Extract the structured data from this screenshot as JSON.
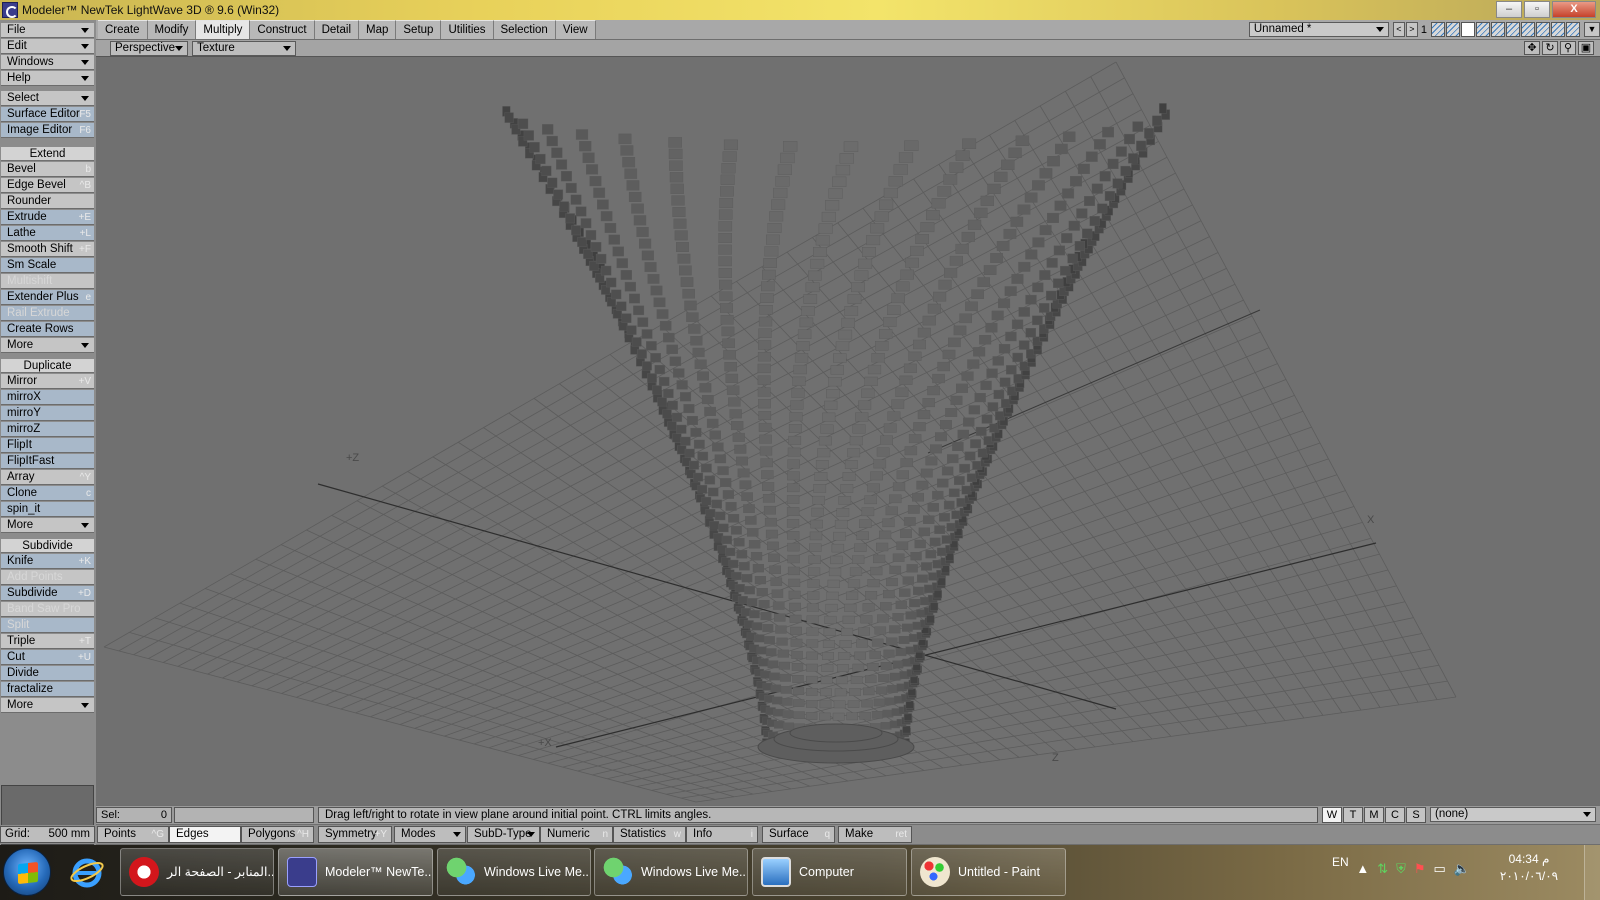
{
  "window": {
    "title": "Modeler™ NewTek LightWave 3D ® 9.6  (Win32)",
    "min": "–",
    "max": "▫",
    "close": "X"
  },
  "tabs": [
    "Create",
    "Modify",
    "Multiply",
    "Construct",
    "Detail",
    "Map",
    "Setup",
    "Utilities",
    "Selection",
    "View"
  ],
  "active_tab": "Multiply",
  "layer": {
    "name": "Unnamed *",
    "number": "1"
  },
  "left_menus": [
    "File",
    "Edit",
    "Windows",
    "Help"
  ],
  "left_tools": {
    "select": "Select",
    "surface_editor": "Surface Editor",
    "surface_key": "F5",
    "image_editor": "Image Editor",
    "image_key": "F6"
  },
  "extend": {
    "header": "Extend",
    "items": [
      {
        "label": "Bevel",
        "key": "b"
      },
      {
        "label": "Edge Bevel",
        "key": "^B"
      },
      {
        "label": "Rounder",
        "key": ""
      },
      {
        "label": "Extrude",
        "key": "+E"
      },
      {
        "label": "Lathe",
        "key": "+L"
      },
      {
        "label": "Smooth Shift",
        "key": "+F"
      },
      {
        "label": "Sm Scale",
        "key": ""
      },
      {
        "label": "Multishift",
        "key": ""
      },
      {
        "label": "Extender Plus",
        "key": "e"
      },
      {
        "label": "Rail Extrude",
        "key": ""
      },
      {
        "label": "Create Rows",
        "key": ""
      },
      {
        "label": "More",
        "key": ""
      }
    ]
  },
  "duplicate": {
    "header": "Duplicate",
    "items": [
      {
        "label": "Mirror",
        "key": "+V"
      },
      {
        "label": "mirroX",
        "key": ""
      },
      {
        "label": "mirroY",
        "key": ""
      },
      {
        "label": "mirroZ",
        "key": ""
      },
      {
        "label": "FlipIt",
        "key": ""
      },
      {
        "label": "FlipItFast",
        "key": ""
      },
      {
        "label": "Array",
        "key": "^Y"
      },
      {
        "label": "Clone",
        "key": "c"
      },
      {
        "label": "spin_it",
        "key": ""
      },
      {
        "label": "More",
        "key": ""
      }
    ]
  },
  "subdivide": {
    "header": "Subdivide",
    "items": [
      {
        "label": "Knife",
        "key": "+K"
      },
      {
        "label": "Add Points",
        "key": ""
      },
      {
        "label": "Subdivide",
        "key": "+D"
      },
      {
        "label": "Band Saw Pro",
        "key": ""
      },
      {
        "label": "Split",
        "key": ""
      },
      {
        "label": "Triple",
        "key": "+T"
      },
      {
        "label": "Cut",
        "key": "+U"
      },
      {
        "label": "Divide",
        "key": ""
      },
      {
        "label": "fractalize",
        "key": ""
      },
      {
        "label": "More",
        "key": ""
      }
    ]
  },
  "viewport": {
    "view": "Perspective",
    "render": "Texture",
    "axis_labels": [
      "+Z",
      "X",
      "+X",
      "Z"
    ],
    "icons": [
      "move-icon",
      "rotate-icon",
      "zoom-icon",
      "maximize-icon"
    ]
  },
  "status": {
    "sel_label": "Sel:",
    "sel_value": "0",
    "message": "Drag left/right to rotate in view plane around initial point. CTRL limits angles.",
    "view_buttons": [
      "W",
      "T",
      "M",
      "C",
      "S"
    ],
    "active_view_button": "W",
    "surface_filter": "(none)",
    "grid_label": "Grid:",
    "grid_value": "500 mm",
    "modes": [
      {
        "label": "Points",
        "key": "^G"
      },
      {
        "label": "Edges",
        "key": ""
      },
      {
        "label": "Polygons",
        "key": "^H"
      },
      {
        "label": "Symmetry",
        "key": "+Y"
      },
      {
        "label": "Modes",
        "key": ""
      },
      {
        "label": "SubD-Type",
        "key": ""
      },
      {
        "label": "Numeric",
        "key": "n"
      },
      {
        "label": "Statistics",
        "key": "w"
      },
      {
        "label": "Info",
        "key": "i"
      },
      {
        "label": "Surface",
        "key": "q"
      },
      {
        "label": "Make",
        "key": "ret"
      }
    ],
    "active_mode": "Edges"
  },
  "taskbar": {
    "tasks": [
      "المنابر - الصفحة الر...",
      "Modeler™ NewTe...",
      "Windows Live Me...",
      "Windows Live Me...",
      "Computer",
      "Untitled - Paint"
    ],
    "lang": "EN",
    "time": "04:34 م",
    "date": "٢٠١٠/٠٦/٠٩"
  },
  "colors": {
    "viewport_bg": "#707070",
    "mesh": "#5a5a5a",
    "grid": "#5c5c5c",
    "panel": "#c5c5c5"
  }
}
